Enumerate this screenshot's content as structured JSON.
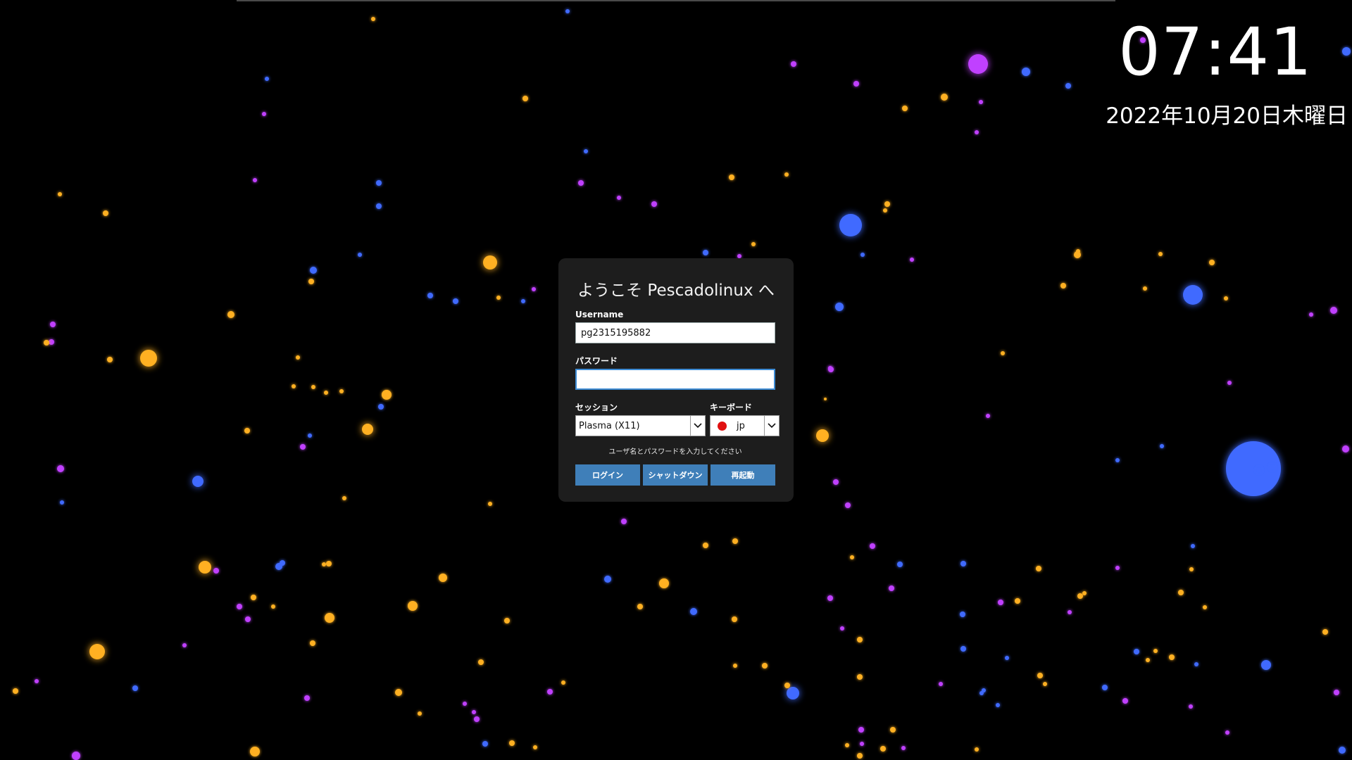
{
  "clock": {
    "time": "07:41",
    "date": "2022年10月20日木曜日"
  },
  "login": {
    "welcome": "ようこそ Pescadolinux へ",
    "username_label": "Username",
    "username_value": "pg2315195882",
    "password_label": "パスワード",
    "password_value": "",
    "session_label": "セッション",
    "session_value": "Plasma (X11)",
    "keyboard_label": "キーボード",
    "keyboard_value": "jp",
    "hint": "ユーザ名とパスワードを入力してください",
    "buttons": {
      "login": "ログイン",
      "shutdown": "シャットダウン",
      "reboot": "再起動"
    }
  },
  "colors": {
    "background": "#000000",
    "panel": "#1d1d1d",
    "button": "#3f7fb9",
    "flag": "#e01010",
    "star_orange": "#ffb020",
    "star_blue": "#3f6bff",
    "star_purple": "#c040ff"
  },
  "icons": {
    "session_dropdown": "chevron-down-icon",
    "keyboard_dropdown": "chevron-down-icon",
    "keyboard_flag": "japan-flag-icon"
  }
}
